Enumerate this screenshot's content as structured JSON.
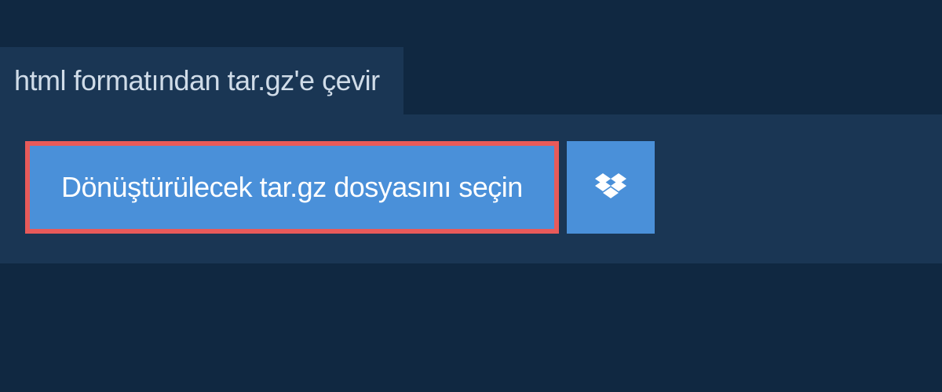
{
  "header": {
    "title": "html formatından tar.gz'e çevir"
  },
  "actions": {
    "select_file_label": "Dönüştürülecek tar.gz dosyasını seçin",
    "dropbox_icon_name": "dropbox"
  },
  "colors": {
    "background": "#102841",
    "panel": "#1a3654",
    "button_primary": "#4a90d9",
    "highlight_border": "#e85a5a",
    "text_light": "#d0dce8",
    "text_white": "#ffffff"
  }
}
